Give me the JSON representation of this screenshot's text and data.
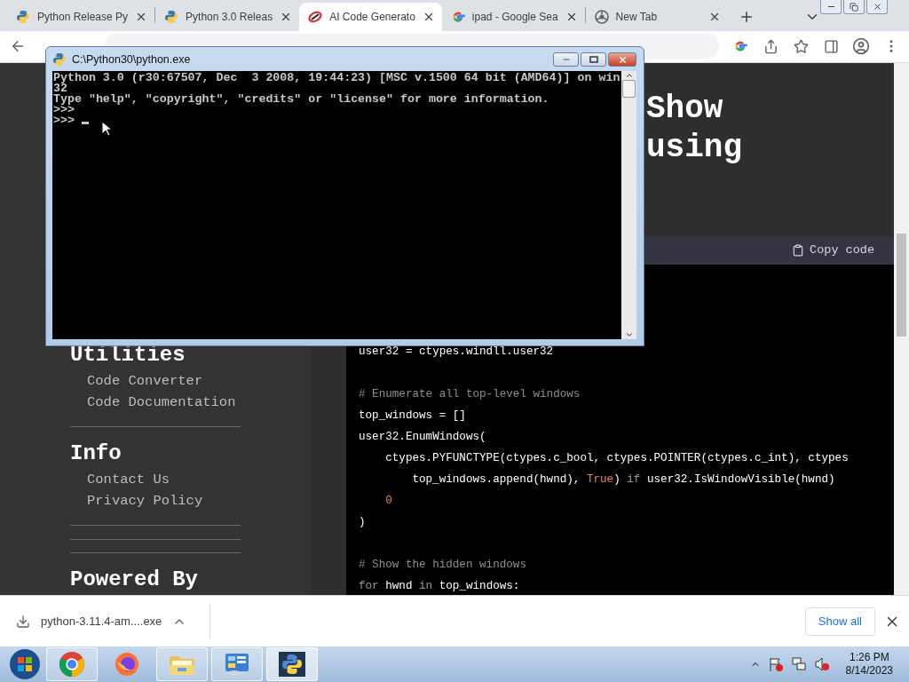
{
  "browser": {
    "tabs": [
      {
        "kind": "python",
        "title": "Python Release Py",
        "selected": false
      },
      {
        "kind": "python",
        "title": "Python 3.0 Releas",
        "selected": false
      },
      {
        "kind": "ai",
        "title": "AI Code Generato",
        "selected": true
      },
      {
        "kind": "google",
        "title": "ipad - Google Sea",
        "selected": false
      },
      {
        "kind": "chrome",
        "title": "New Tab",
        "selected": false
      }
    ]
  },
  "page": {
    "sidebar": [
      {
        "kind": "heading",
        "text": "Utilities"
      },
      {
        "kind": "link",
        "text": "Code Converter"
      },
      {
        "kind": "link",
        "text": "Code Documentation"
      },
      {
        "kind": "divider"
      },
      {
        "kind": "heading",
        "text": "Info"
      },
      {
        "kind": "link",
        "text": "Contact Us"
      },
      {
        "kind": "link",
        "text": "Privacy Policy"
      },
      {
        "kind": "divider"
      },
      {
        "kind": "divider"
      },
      {
        "kind": "divider"
      },
      {
        "kind": "heading",
        "text": "Powered By"
      }
    ],
    "title_lines": [
      "Show",
      "using"
    ],
    "code_block": {
      "copy_label": "Copy code",
      "blocks": [
        [
          {
            "tokens": [
              {
                "kind": "plain",
                "text": "user32 = ctypes.windll.user32"
              }
            ]
          }
        ],
        [
          {
            "tokens": [
              {
                "kind": "comment",
                "text": "# Enumerate all top-level windows"
              }
            ]
          },
          {
            "tokens": [
              {
                "kind": "plain",
                "text": "top_windows = []"
              }
            ]
          },
          {
            "tokens": [
              {
                "kind": "plain",
                "text": "user32.EnumWindows("
              }
            ],
            "children": [
              {
                "tokens": [
                  {
                    "kind": "plain",
                    "text": "ctypes.PYFUNCTYPE(ctypes.c_bool, ctypes.POINTER(ctypes.c_int), ctypes"
                  }
                ],
                "children": [
                  {
                    "tokens": [
                      {
                        "kind": "plain",
                        "text": "top_windows.append(hwnd), "
                      },
                      {
                        "kind": "literal",
                        "text": "True"
                      },
                      {
                        "kind": "plain",
                        "text": ") "
                      },
                      {
                        "kind": "keyword",
                        "text": "if"
                      },
                      {
                        "kind": "plain",
                        "text": " user32.IsWindowVisible(hwnd)"
                      }
                    ]
                  }
                ]
              },
              {
                "tokens": [
                  {
                    "kind": "literal",
                    "text": "0"
                  }
                ]
              }
            ]
          },
          {
            "tokens": [
              {
                "kind": "plain",
                "text": ")"
              }
            ]
          }
        ],
        [
          {
            "tokens": [
              {
                "kind": "comment",
                "text": "# Show the hidden windows"
              }
            ]
          },
          {
            "tokens": [
              {
                "kind": "keyword",
                "text": "for"
              },
              {
                "kind": "plain",
                "text": " hwnd "
              },
              {
                "kind": "keyword",
                "text": "in"
              },
              {
                "kind": "plain",
                "text": " top_windows:"
              }
            ]
          }
        ]
      ]
    }
  },
  "console": {
    "title": "C:\\Python30\\python.exe",
    "lines": [
      "Python 3.0 (r30:67507, Dec  3 2008, 19:44:23) [MSC v.1500 64 bit (AMD64)] on win",
      "32",
      "Type \"help\", \"copyright\", \"credits\" or \"license\" for more information.",
      ">>>",
      ">>> "
    ]
  },
  "downloads": {
    "file": "python-3.11.4-am....exe",
    "show_all": "Show all"
  },
  "taskbar": {
    "apps": [
      {
        "kind": "chrome",
        "running": true,
        "selected": false
      },
      {
        "kind": "firefox",
        "running": false,
        "selected": false
      },
      {
        "kind": "folder",
        "running": true,
        "selected": false
      },
      {
        "kind": "control",
        "running": true,
        "selected": false
      },
      {
        "kind": "python",
        "running": true,
        "selected": true
      }
    ],
    "time": "1:26 PM",
    "date": "8/14/2023"
  }
}
